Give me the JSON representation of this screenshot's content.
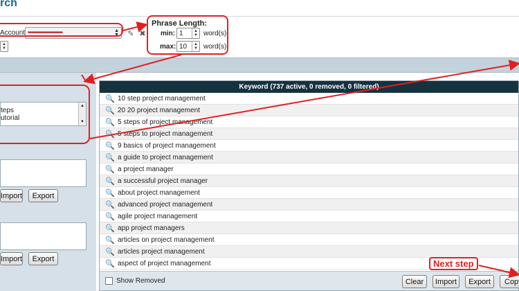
{
  "header": {
    "title": "rch"
  },
  "account": {
    "label": "Account:",
    "value": "••••••••••••••••••••"
  },
  "phrase_length": {
    "title": "Phrase Length:",
    "min_label": "min:",
    "min_value": "1",
    "min_unit": "word(s)",
    "max_label": "max:",
    "max_value": "10",
    "max_unit": "word(s)"
  },
  "left_panel": {
    "list_items": [
      "teps",
      "utorial"
    ],
    "import_label": "Import",
    "export_label": "Export"
  },
  "keywords": {
    "header": "Keyword (737 active, 0 removed, 0 filtered)",
    "rows": [
      "10 step project management",
      "20 20 project management",
      "5 steps of project management",
      "5 steps to project management",
      "9 basics of project management",
      "a guide to project management",
      "a project manager",
      "a successful project manager",
      "about project management",
      "advanced project management",
      "agile project management",
      "app project managers",
      "articles on project management",
      "articles project management",
      "aspect of project management"
    ],
    "show_removed_label": "Show Removed",
    "clear_label": "Clear",
    "import_label": "Import",
    "export_label": "Export",
    "copy_label": "Copy"
  },
  "annotation": {
    "next_step": "Next step"
  },
  "colors": {
    "accent_red": "#e02020",
    "header_dark": "#16323f",
    "title_blue": "#1a6a8a"
  }
}
